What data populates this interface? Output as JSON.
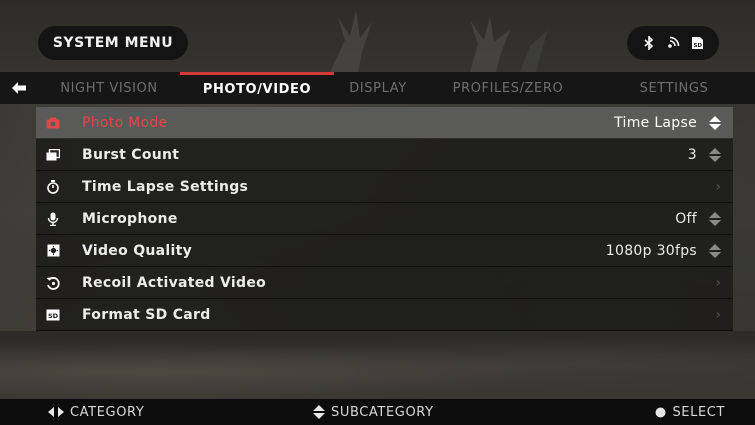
{
  "header": {
    "title": "SYSTEM MENU",
    "status_icons": [
      "bluetooth-icon",
      "wifi-icon",
      "sd-card-icon"
    ]
  },
  "tabs": [
    {
      "label": "NIGHT VISION",
      "active": false
    },
    {
      "label": "PHOTO/VIDEO",
      "active": true
    },
    {
      "label": "DISPLAY",
      "active": false
    },
    {
      "label": "PROFILES/ZERO",
      "active": false
    },
    {
      "label": "SETTINGS",
      "active": false
    }
  ],
  "menu": {
    "items": [
      {
        "label": "Photo Mode",
        "value": "Time Lapse",
        "icon": "camera-icon",
        "control": "updown",
        "selected": true
      },
      {
        "label": "Burst Count",
        "value": "3",
        "icon": "burst-icon",
        "control": "updown",
        "selected": false
      },
      {
        "label": "Time Lapse Settings",
        "value": "",
        "icon": "stopwatch-icon",
        "control": "chevron",
        "selected": false
      },
      {
        "label": "Microphone",
        "value": "Off",
        "icon": "microphone-icon",
        "control": "updown",
        "selected": false
      },
      {
        "label": "Video Quality",
        "value": "1080p 30fps",
        "icon": "video-quality-icon",
        "control": "updown",
        "selected": false
      },
      {
        "label": "Recoil Activated Video",
        "value": "",
        "icon": "recoil-icon",
        "control": "chevron",
        "selected": false
      },
      {
        "label": "Format SD Card",
        "value": "",
        "icon": "sd-format-icon",
        "control": "chevron",
        "selected": false
      }
    ]
  },
  "footer": {
    "category": "CATEGORY",
    "subcategory": "SUBCATEGORY",
    "select": "SELECT"
  },
  "colors": {
    "accent": "#d33a3a",
    "selected_row": "#5a5a58",
    "bar_bg": "#161616"
  }
}
